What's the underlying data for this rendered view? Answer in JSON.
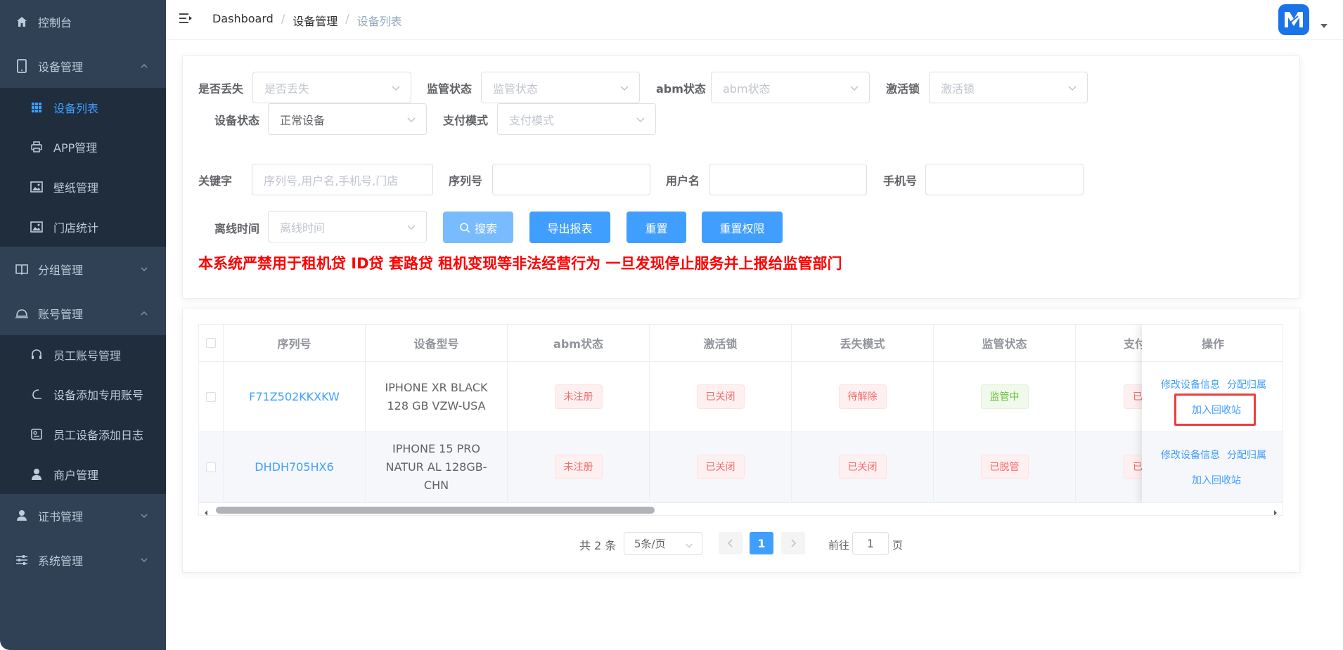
{
  "sidebar": {
    "items": [
      {
        "label": "控制台",
        "icon": "home-icon"
      },
      {
        "label": "设备管理",
        "icon": "tablet-icon"
      },
      {
        "label": "分组管理",
        "icon": "book-icon"
      },
      {
        "label": "账号管理",
        "icon": "bell-icon"
      },
      {
        "label": "证书管理",
        "icon": "user-icon"
      },
      {
        "label": "系统管理",
        "icon": "sliders-icon"
      }
    ],
    "device_sub": [
      {
        "label": "设备列表",
        "icon": "grid-icon"
      },
      {
        "label": "APP管理",
        "icon": "printer-icon"
      },
      {
        "label": "壁纸管理",
        "icon": "picture-icon"
      },
      {
        "label": "门店统计",
        "icon": "picture-icon"
      }
    ],
    "account_sub": [
      {
        "label": "员工账号管理",
        "icon": "headset-icon"
      },
      {
        "label": "设备添加专用账号",
        "icon": "moon-icon"
      },
      {
        "label": "员工设备添加日志",
        "icon": "log-icon"
      },
      {
        "label": "商户管理",
        "icon": "person-icon"
      }
    ]
  },
  "breadcrumb": [
    "Dashboard",
    "设备管理",
    "设备列表"
  ],
  "filters": {
    "lost": {
      "label": "是否丢失",
      "placeholder": "是否丢失"
    },
    "supervise": {
      "label": "监管状态",
      "placeholder": "监管状态"
    },
    "abm": {
      "label": "abm状态",
      "placeholder": "abm状态"
    },
    "activation": {
      "label": "激活锁",
      "placeholder": "激活锁"
    },
    "device_status": {
      "label": "设备状态",
      "value": "正常设备"
    },
    "pay_mode": {
      "label": "支付模式",
      "placeholder": "支付模式"
    },
    "keyword": {
      "label": "关键字",
      "placeholder": "序列号,用户名,手机号,门店"
    },
    "serial": {
      "label": "序列号",
      "value": ""
    },
    "username": {
      "label": "用户名",
      "value": ""
    },
    "phone": {
      "label": "手机号",
      "value": ""
    },
    "offline": {
      "label": "离线时间",
      "placeholder": "离线时间"
    }
  },
  "buttons": {
    "search": "搜索",
    "export": "导出报表",
    "reset": "重置",
    "reset_perm": "重置权限"
  },
  "warning": "本系统严禁用于租机贷 ID贷 套路贷 租机变现等非法经营行为 一旦发现停止服务并上报给监管部门",
  "table": {
    "headers": [
      "序列号",
      "设备型号",
      "abm状态",
      "激活锁",
      "丢失模式",
      "监管状态",
      "支付",
      "操作"
    ],
    "rows": [
      {
        "serial": "F71Z502KKXKW",
        "model": "IPHONE XR BLACK 128 GB VZW-USA",
        "abm": "未注册",
        "activation": "已关闭",
        "lost": "待解除",
        "supervise": "监管中",
        "pay": "已"
      },
      {
        "serial": "DHDH705HX6",
        "model": "IPHONE 15 PRO NATUR AL 128GB-CHN",
        "abm": "未注册",
        "activation": "已关闭",
        "lost": "已关闭",
        "supervise": "已脱管",
        "pay": "已"
      }
    ],
    "ops": {
      "edit": "修改设备信息",
      "assign": "分配归属",
      "recycle": "加入回收站"
    }
  },
  "pagination": {
    "total": "共 2 条",
    "page_size": "5条/页",
    "current": "1",
    "goto_label": "前往",
    "goto_value": "1",
    "page_unit": "页"
  },
  "colors": {
    "primary": "#409eff",
    "sidebar": "#304156",
    "danger": "#f56c6c",
    "success": "#67c23a",
    "warning_text": "#ff0000"
  }
}
